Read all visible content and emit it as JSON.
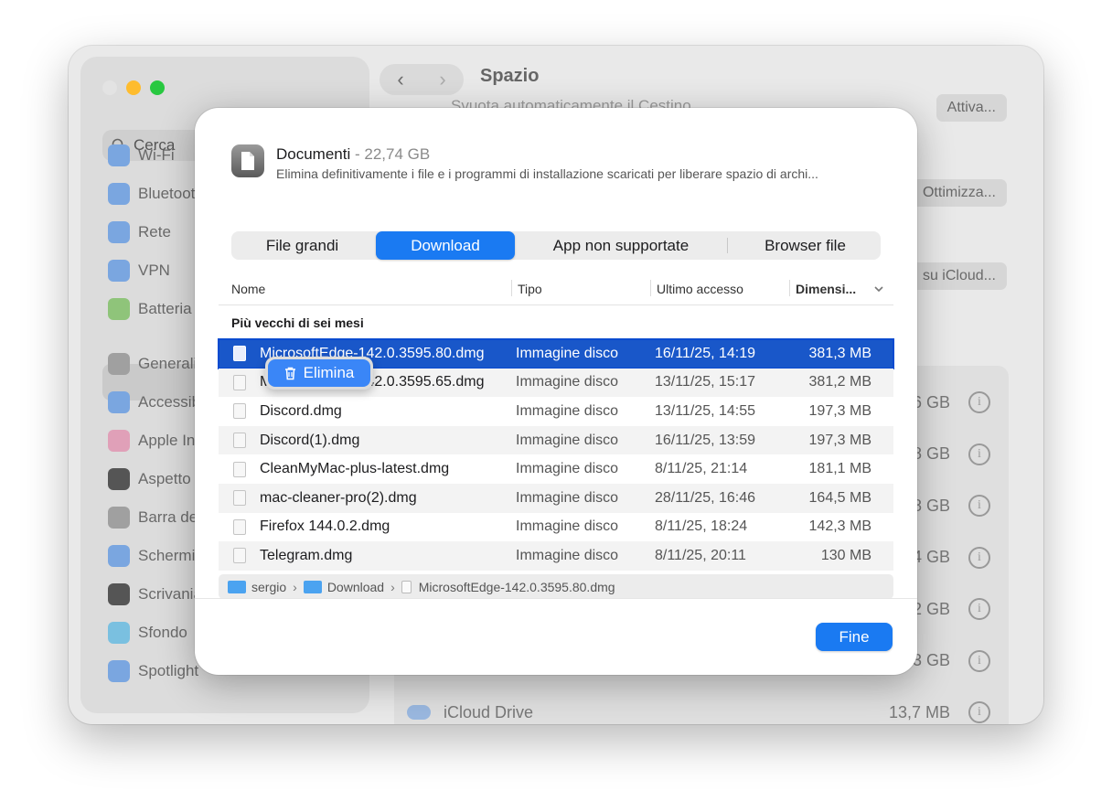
{
  "window": {
    "title": "Spazio",
    "traffic_colors": [
      "#e3e3e3",
      "#febc2e",
      "#28c840"
    ]
  },
  "sidebar": {
    "search_placeholder": "Cerca",
    "items": [
      {
        "label": "Wi-Fi",
        "icon": "wifi-icon",
        "color": "#7aa6e0"
      },
      {
        "label": "Bluetooth",
        "icon": "bluetooth-icon",
        "color": "#7aa6e0"
      },
      {
        "label": "Rete",
        "icon": "globe-icon",
        "color": "#7aa6e0"
      },
      {
        "label": "VPN",
        "icon": "globe-icon",
        "color": "#7aa6e0"
      },
      {
        "label": "Batteria",
        "icon": "battery-icon",
        "color": "#8fc47a"
      },
      {
        "label": "Generali",
        "icon": "gear-icon",
        "color": "#a0a0a0"
      },
      {
        "label": "Accessibi",
        "icon": "accessibility-icon",
        "color": "#7aa6e0"
      },
      {
        "label": "Apple Inte",
        "icon": "apple-intelligence-icon",
        "color": "#e0a0b8"
      },
      {
        "label": "Aspetto",
        "icon": "appearance-icon",
        "color": "#555555"
      },
      {
        "label": "Barra dei",
        "icon": "control-center-icon",
        "color": "#a0a0a0"
      },
      {
        "label": "Schermi",
        "icon": "brightness-icon",
        "color": "#7aa6e0"
      },
      {
        "label": "Scrivania",
        "icon": "desktop-icon",
        "color": "#555555"
      },
      {
        "label": "Sfondo",
        "icon": "wallpaper-icon",
        "color": "#7ac0e0"
      },
      {
        "label": "Spotlight",
        "icon": "spotlight-icon",
        "color": "#7aa6e0"
      }
    ]
  },
  "main": {
    "ghost_text": "Svuota automaticamente il Cestino",
    "buttons": {
      "attiva": "Attiva...",
      "ottimizza": "Ottimizza...",
      "icloud": "su iCloud..."
    },
    "storage_rows": [
      {
        "value": "4,96 GB"
      },
      {
        "value": "3,58 GB"
      },
      {
        "value": "2,38 GB"
      },
      {
        "value": "2,74 GB"
      },
      {
        "value": "4,2 GB"
      },
      {
        "value": "1,33 GB"
      },
      {
        "label": "iCloud Drive",
        "value": "13,7 MB"
      }
    ]
  },
  "dialog": {
    "title": "Documenti",
    "size": " - 22,74 GB",
    "description": "Elimina definitivamente i file e i programmi di installazione scaricati per liberare spazio di archi...",
    "tabs": [
      "File grandi",
      "Download",
      "App non supportate",
      "Browser file"
    ],
    "active_tab": "Download",
    "columns": {
      "name": "Nome",
      "type": "Tipo",
      "accessed": "Ultimo accesso",
      "size": "Dimensi..."
    },
    "group_label": "Più vecchi di sei mesi",
    "rows": [
      {
        "name": "MicrosoftEdge-142.0.3595.80.dmg",
        "type": "Immagine disco",
        "date": "16/11/25, 14:19",
        "size": "381,3 MB"
      },
      {
        "name": "MicrosoftEdge-142.0.3595.65.dmg",
        "type": "Immagine disco",
        "date": "13/11/25, 15:17",
        "size": "381,2 MB"
      },
      {
        "name": "Discord.dmg",
        "type": "Immagine disco",
        "date": "13/11/25, 14:55",
        "size": "197,3 MB"
      },
      {
        "name": "Discord(1).dmg",
        "type": "Immagine disco",
        "date": "16/11/25, 13:59",
        "size": "197,3 MB"
      },
      {
        "name": "CleanMyMac-plus-latest.dmg",
        "type": "Immagine disco",
        "date": "8/11/25, 21:14",
        "size": "181,1 MB"
      },
      {
        "name": "mac-cleaner-pro(2).dmg",
        "type": "Immagine disco",
        "date": "28/11/25, 16:46",
        "size": "164,5 MB"
      },
      {
        "name": "Firefox 144.0.2.dmg",
        "type": "Immagine disco",
        "date": "8/11/25, 18:24",
        "size": "142,3 MB"
      },
      {
        "name": "Telegram.dmg",
        "type": "Immagine disco",
        "date": "8/11/25, 20:11",
        "size": "130 MB"
      }
    ],
    "path": {
      "user": "sergio",
      "folder": "Download",
      "file": "MicrosoftEdge-142.0.3595.80.dmg"
    },
    "context_menu": {
      "label": "Elimina"
    },
    "done_label": "Fine",
    "accent": "#1a7af2"
  }
}
